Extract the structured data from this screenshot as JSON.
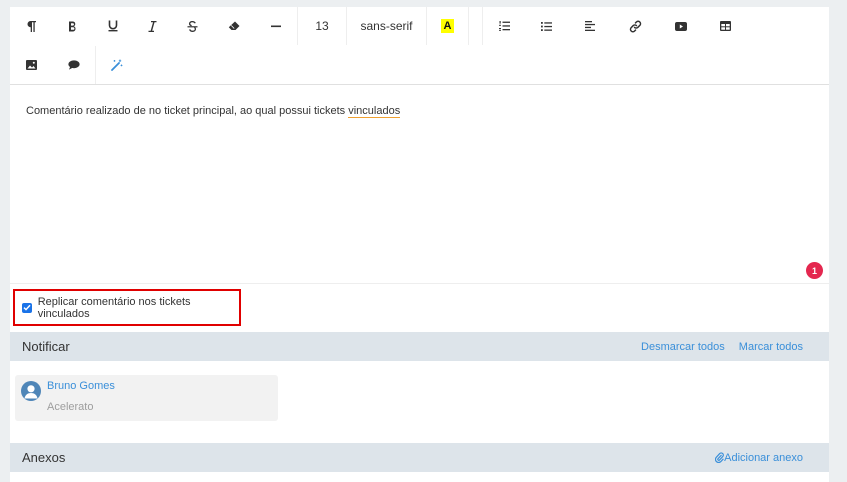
{
  "toolbar": {
    "font_size": "13",
    "font_family": "sans-serif",
    "highlight_letter": "A",
    "row1_icons": [
      "pilcrow-icon",
      "bold-icon",
      "underline-icon",
      "italic-icon",
      "strikethrough-icon",
      "eraser-icon",
      "horizontal-rule-icon"
    ],
    "row1b_icons": [
      "ordered-list-icon",
      "unordered-list-icon",
      "align-left-icon",
      "link-icon",
      "video-icon",
      "table-icon"
    ],
    "row2_icons": [
      "image-icon",
      "comment-icon",
      "magic-wand-icon"
    ]
  },
  "editor": {
    "text_before": "Comentário realizado de no ticket principal, ao qual possui tickets ",
    "text_underlined": "vinculados",
    "badge_count": "1"
  },
  "replicate": {
    "checked": true,
    "label": "Replicar comentário nos tickets vinculados"
  },
  "notify": {
    "title": "Notificar",
    "unmark_all": "Desmarcar todos",
    "mark_all": "Marcar todos",
    "users": [
      {
        "name": "Bruno Gomes",
        "org": "Acelerato"
      }
    ]
  },
  "attachments": {
    "title": "Anexos",
    "add_label": "Adicionar anexo"
  },
  "colors": {
    "accent": "#3a8fd9",
    "checkbox": "#1a73e8",
    "badge": "#e4274f",
    "highlight_box": "#e00000",
    "section_bg": "#dde4ea"
  }
}
